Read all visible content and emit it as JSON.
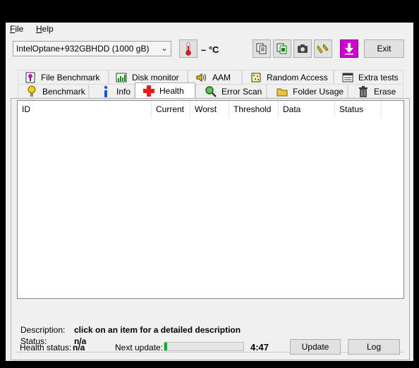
{
  "menu": {
    "file": "File",
    "help": "Help"
  },
  "toolbar": {
    "drive": "IntelOptane+932GBHDD (1000 gB)",
    "temperature": "– °C",
    "exit_label": "Exit",
    "icons": [
      "copy-text-icon",
      "copy-sheet-icon",
      "camera-icon",
      "options-icon",
      "download-icon"
    ]
  },
  "tabs_row1": [
    {
      "label": "File Benchmark",
      "icon": "file-benchmark-icon"
    },
    {
      "label": "Disk monitor",
      "icon": "disk-monitor-icon"
    },
    {
      "label": "AAM",
      "icon": "speaker-icon"
    },
    {
      "label": "Random Access",
      "icon": "random-access-icon"
    },
    {
      "label": "Extra tests",
      "icon": "extra-tests-icon"
    }
  ],
  "tabs_row2": [
    {
      "label": "Benchmark",
      "icon": "benchmark-icon"
    },
    {
      "label": "Info",
      "icon": "info-icon"
    },
    {
      "label": "Health",
      "icon": "health-cross-icon"
    },
    {
      "label": "Error Scan",
      "icon": "magnifier-icon"
    },
    {
      "label": "Folder Usage",
      "icon": "folder-icon"
    },
    {
      "label": "Erase",
      "icon": "trash-icon"
    }
  ],
  "active_tab": "Health",
  "table": {
    "columns": [
      "ID",
      "Current",
      "Worst",
      "Threshold",
      "Data",
      "Status"
    ]
  },
  "details": {
    "description_label": "Description:",
    "description_value": "click on an item for a detailed description",
    "status_label": "Status:",
    "status_value": "n/a"
  },
  "footer": {
    "health_label": "Health status:",
    "health_value": "n/a",
    "next_update_label": "Next update:",
    "countdown": "4:47",
    "progress": 0.04,
    "update_label": "Update",
    "log_label": "Log"
  },
  "colors": {
    "progress_fill": "#06b025",
    "accent_pink": "#d000d0"
  }
}
